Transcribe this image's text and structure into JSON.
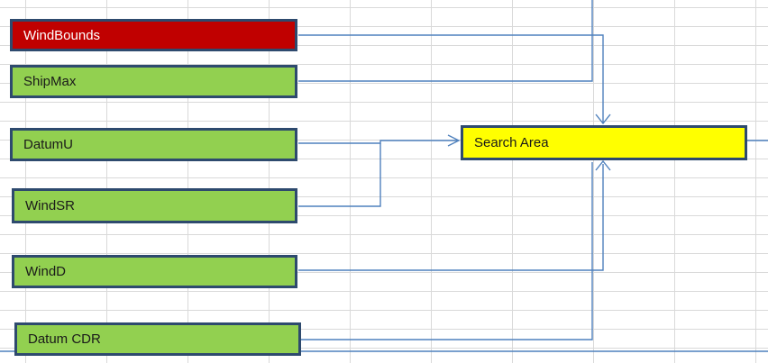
{
  "nodes": {
    "wind_bounds": "WindBounds",
    "ship_max": "ShipMax",
    "datum_u": "DatumU",
    "wind_sr": "WindSR",
    "wind_d": "WindD",
    "datum_cdr": "Datum CDR",
    "search_area": "Search Area"
  },
  "colors": {
    "error_node": "#c00000",
    "input_node": "#92d050",
    "output_node": "#ffff00",
    "node_border": "#2e4a6e",
    "connector": "#4f81bd",
    "gridline": "#d9d9d9"
  }
}
